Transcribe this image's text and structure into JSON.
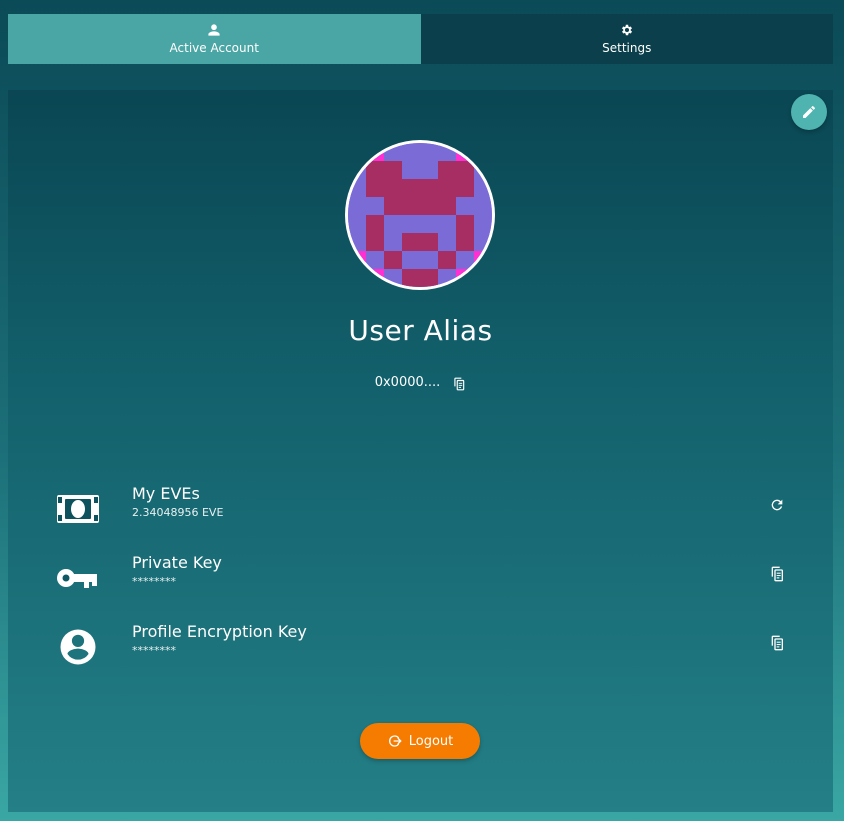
{
  "tabs": [
    {
      "label": "Active Account",
      "icon": "person-icon",
      "active": true
    },
    {
      "label": "Settings",
      "icon": "gear-icon",
      "active": false
    }
  ],
  "profile": {
    "alias": "User Alias",
    "address": "0x0000....",
    "avatar_icon": "identicon-avatar"
  },
  "items": [
    {
      "title": "My EVEs",
      "subtitle": "2.34048956 EVE",
      "lead_icon": "money-icon",
      "action_icon": "refresh-icon"
    },
    {
      "title": "Private Key",
      "subtitle": "********",
      "lead_icon": "key-icon",
      "action_icon": "copy-icon"
    },
    {
      "title": "Profile Encryption Key",
      "subtitle": "********",
      "lead_icon": "account-circle-icon",
      "action_icon": "copy-icon"
    }
  ],
  "logout": {
    "label": "Logout",
    "icon": "logout-icon"
  },
  "colors": {
    "tab_active": "#4aa6a5",
    "tab_inactive": "#0b3f4b",
    "fab": "#4fb3b0",
    "logout": "#f57c00",
    "avatar_bg": "#7b6bd6",
    "avatar_dark": "#a62e63",
    "avatar_pink": "#ff2fd2"
  }
}
